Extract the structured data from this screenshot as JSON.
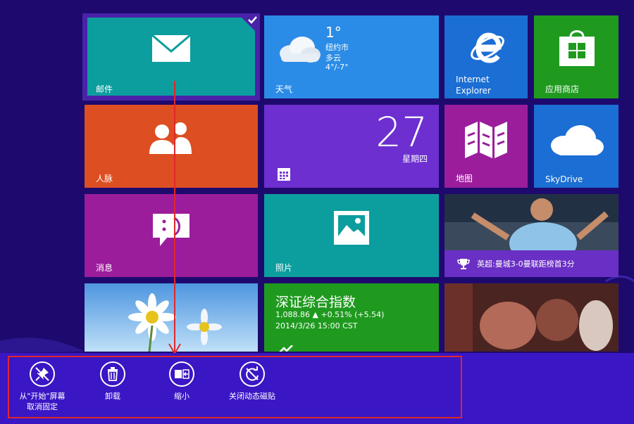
{
  "tiles": {
    "mail": {
      "label": "邮件",
      "color": "#0c9e9e"
    },
    "weather": {
      "label": "天气",
      "temp": "1°",
      "city": "纽约市",
      "cond": "多云",
      "range": "4°/-7°",
      "color": "#2a8ce6"
    },
    "ie": {
      "label_line1": "Internet",
      "label_line2": "Explorer",
      "color": "#1b6ed3"
    },
    "store": {
      "label": "应用商店",
      "color": "#1f9a1f"
    },
    "people": {
      "label": "人脉",
      "color": "#dd4e22"
    },
    "calendar": {
      "day": "27",
      "weekday": "星期四",
      "color": "#6d2fd0"
    },
    "maps": {
      "label": "地图",
      "color": "#9b1d9c"
    },
    "skydrive": {
      "label": "SkyDrive",
      "color": "#1b6ed3"
    },
    "messaging": {
      "label": "消息",
      "color": "#9b1d9c"
    },
    "photos": {
      "label": "照片",
      "color": "#0c9e9e"
    },
    "sports": {
      "caption": "英超:曼城3-0曼联距榜首3分"
    },
    "finance": {
      "title": "深证综合指数",
      "line1": "1,088.86 ▲ +0.51% (+5.54)",
      "line2": "2014/3/26 15:00 CST",
      "color": "#1f9a1f"
    }
  },
  "appbar": {
    "unpin_line1": "从\"开始\"屏幕",
    "unpin_line2": "取消固定",
    "uninstall": "卸载",
    "resize": "缩小",
    "live_tile_off": "关闭动态磁贴"
  }
}
